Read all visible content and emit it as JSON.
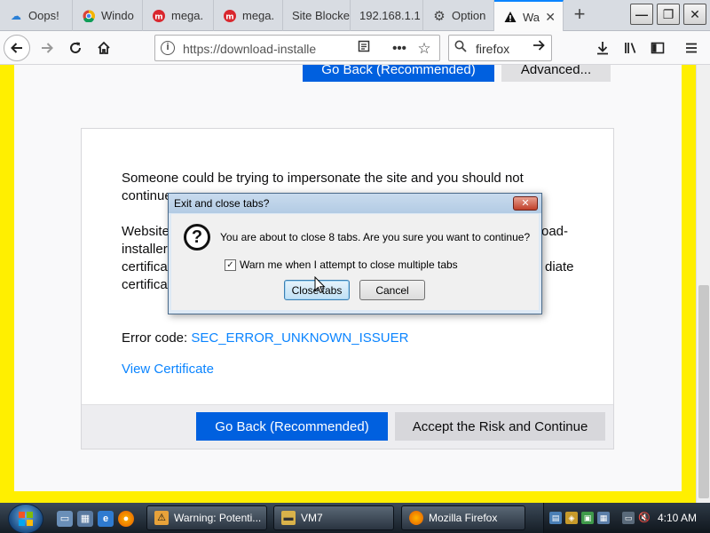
{
  "browser": {
    "tabs": [
      {
        "title": "Oops!",
        "icon": "cloud-icon",
        "active": false
      },
      {
        "title": "Windo",
        "icon": "chrome-icon",
        "active": false
      },
      {
        "title": "mega.",
        "icon": "mega-icon",
        "active": false
      },
      {
        "title": "mega.",
        "icon": "mega-icon",
        "active": false
      },
      {
        "title": "Site Blocke",
        "icon": "",
        "active": false
      },
      {
        "title": "192.168.1.1",
        "icon": "",
        "active": false
      },
      {
        "title": "Option",
        "icon": "gear-icon",
        "active": false
      },
      {
        "title": "Wa",
        "icon": "warning-icon",
        "active": true
      }
    ],
    "url": "https://download-installe",
    "search_value": "firefox"
  },
  "page": {
    "top_go_back": "Go Back (Recommended)",
    "top_advanced": "Advanced...",
    "para1_line1": "Someone could be trying to impersonate the site and you should not",
    "para1_line2": "continue",
    "para2_left": [
      "Website",
      "installer",
      "certifica",
      "certifica"
    ],
    "para2_right": [
      "oad-",
      "",
      "diate",
      ""
    ],
    "error_label": "Error code: ",
    "error_code": "SEC_ERROR_UNKNOWN_ISSUER",
    "view_cert": "View Certificate",
    "go_back": "Go Back (Recommended)",
    "accept": "Accept the Risk and Continue"
  },
  "dialog": {
    "title": "Exit and close tabs?",
    "close_glyph": "✕",
    "message": "You are about to close 8 tabs. Are you sure you want to continue?",
    "checkbox_label": "Warn me when I attempt to close multiple tabs",
    "checkbox_checked": true,
    "close_tabs": "Close tabs",
    "cancel": "Cancel"
  },
  "taskbar": {
    "items": [
      {
        "label": "Warning: Potenti...",
        "icon": "firefox-warning-icon"
      },
      {
        "label": "VM7",
        "icon": "folder-icon"
      },
      {
        "label": "Mozilla Firefox",
        "icon": "firefox-icon"
      }
    ],
    "clock": "4:10 AM"
  },
  "colors": {
    "accent_blue": "#0060df",
    "link_blue": "#0a84ff",
    "page_border": "#ffef00"
  }
}
